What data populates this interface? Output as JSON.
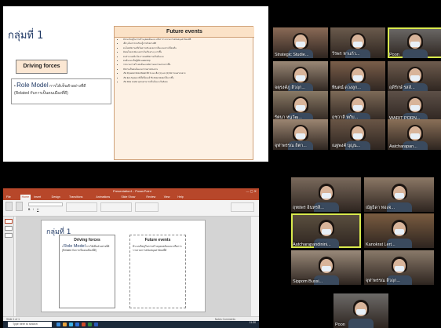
{
  "slide": {
    "title": "กลุ่มที่ 1",
    "driving_forces": "Driving forces",
    "role_model_head": "Role Model",
    "role_model_text": "การได้เห็นตัวอย่างที่ดี",
    "related": "(Related กับการเป็นคนเมืองที่ดี)",
    "future_events_title": "Future events",
    "future_events": [
      "มีระบบใหญ่ในการสร้างบุคคลต้นแบบ หรือการรวบรวมการสนับสนุนค่านิยมที่ดี",
      "เด็กๆ ต้องการจะเรียนรู้จากตัวอย่างที่ดี",
      "คนไทยมีความเชื่อในความดี และอยากเป็นแบบอย่างให้คนอื่น",
      "สังคมไทยจะมีแบบอย่างในเรื่องต่างๆ มากขึ้น",
      "คนจำนวนหนึ่ง ต้องการคนที่มีความเป็นต้นแบบ",
      "คนต้นแบบเป็นผู้ที่มี Leadership",
      "กระบวนการสร้างคนต้นแบบมีความหลากหลายมากขึ้น",
      "มีความเป็นคนต้นแบบจากหลายช่องทาง",
      "เกิด Dynamic Role Model ที่มี 3 แบบ คือ (1) และ (2) มีความหลากหลาย",
      "เกิด Eco System ที่เอื้อให้คนเข้าถึง Role Model ได้มากขึ้น",
      "เกิด Role model ทุกคนสามารถเป็นต้นแบบในสังคม"
    ]
  },
  "gallery_top": [
    {
      "name": "Strategic Studie...",
      "tone": "#8a6a56"
    },
    {
      "name": "วีรพร หาแก้ว...",
      "tone": "#6a5a4c"
    },
    {
      "name": "Poon",
      "tone": "#6c6a68",
      "speaking": true
    },
    {
      "name": "จตุรงค์ภู ลีวฤก...",
      "tone": "#9a8876"
    },
    {
      "name": "ทินตน์ ดวงลูก...",
      "tone": "#7a5e4a"
    },
    {
      "name": "ฤดีรักษ์ รสลั...",
      "tone": "#6e5c4e"
    },
    {
      "name": "รัตนา หนูวัฒ...",
      "tone": "#8a7a66"
    },
    {
      "name": "ฤชวาลี หกับ...",
      "tone": "#7d6a58"
    },
    {
      "name": "WARIT PORN...",
      "tone": "#5d5048"
    },
    {
      "name": "จุฬาพรรณ ถิตา...",
      "tone": "#9c8672"
    },
    {
      "name": "ณฐพงค์ บุญน...",
      "tone": "#6a5646"
    },
    {
      "name": "Aatcharapan...",
      "tone": "#8a7058"
    }
  ],
  "gallery_bottom": [
    {
      "name": "ฤทยพร อินทรสิ...",
      "tone": "#7a6a5c"
    },
    {
      "name": "ณัฐธิดา ทองจ...",
      "tone": "#8c7866"
    },
    {
      "name": "Aatcharapandinini...",
      "tone": "#5c5040",
      "speaking": true
    },
    {
      "name": "Kanokrat Lert...",
      "tone": "#7a5c40"
    },
    {
      "name": "Sippom Bussi...",
      "tone": "#9a8a7a"
    },
    {
      "name": "จุฬาพรรณ ลีวฤก...",
      "tone": "#8a7a6a"
    },
    {
      "name": "Poon",
      "tone": "#6c6a68"
    }
  ],
  "ppt": {
    "window_title": "Presentation1 - PowerPoint",
    "tabs": [
      "File",
      "Home",
      "Insert",
      "Design",
      "Transitions",
      "Animations",
      "Slide Show",
      "Review",
      "View",
      "Help"
    ],
    "active_tab": "Home",
    "slide_title": "กลุ่มที่ 1",
    "box1_head": "Driving forces",
    "box1_rm": "Role Model",
    "box1_text": "การได้เห็นตัวอย่างที่ดี",
    "box1_related": "(Related กับการเป็นคนเมืองที่ดี)",
    "box2_head": "Future events",
    "box2_text": "มีระบบใหญ่ในการสร้างบุคคลต้นแบบ หรือการรวบรวมการสนับสนุนค่านิยมที่ดี",
    "status_left": "Slide 1 of 1",
    "status_right": "Notes  Comments",
    "search_placeholder": "Type here to search",
    "clock": "11:30"
  }
}
